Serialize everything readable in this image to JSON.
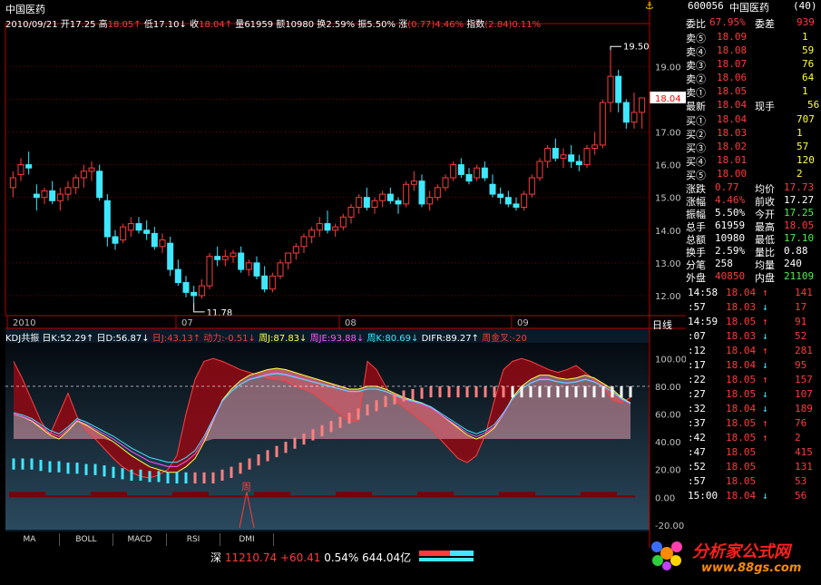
{
  "header": {
    "title": "中国医药",
    "date": "2010/09/21",
    "quote": [
      {
        "label": "开",
        "value": "17.25",
        "dir": "",
        "cls": "white"
      },
      {
        "label": "高",
        "value": "18.05",
        "dir": "↑",
        "cls": "red"
      },
      {
        "label": "低",
        "value": "17.10",
        "dir": "↓",
        "cls": "white"
      },
      {
        "label": "收",
        "value": "18.04",
        "dir": "↑",
        "cls": "red"
      },
      {
        "label": "量",
        "value": "61959",
        "dir": "",
        "cls": "white"
      },
      {
        "label": "额",
        "value": "10980",
        "dir": "",
        "cls": "white"
      },
      {
        "label": "换",
        "value": "2.59%",
        "dir": "",
        "cls": "white"
      },
      {
        "label": "振",
        "value": "5.50%",
        "dir": "",
        "cls": "white"
      },
      {
        "label": "涨",
        "value": "(0.77)4.46%",
        "dir": "",
        "cls": "red"
      },
      {
        "label": "指数",
        "value": "(2.84)0.11%",
        "dir": "",
        "cls": "red"
      }
    ]
  },
  "chart_data": [
    {
      "type": "candlestick",
      "title": "",
      "y_ticks": [
        "19.00",
        "18.00",
        "17.00",
        "16.00",
        "15.00",
        "14.00",
        "13.00",
        "12.00"
      ],
      "ylim": [
        11.5,
        20.2
      ],
      "x_ticks": [
        "2010",
        "07",
        "08",
        "09"
      ],
      "current_price": "18.04",
      "high_marker": "19.50",
      "low_marker": "11.78",
      "candles": [
        [
          15.3,
          15.8,
          15.0,
          15.6
        ],
        [
          15.7,
          16.2,
          15.5,
          16.0
        ],
        [
          16.0,
          16.4,
          15.7,
          15.9
        ],
        [
          15.1,
          15.4,
          14.6,
          15.0
        ],
        [
          15.0,
          15.3,
          14.8,
          15.2
        ],
        [
          15.2,
          15.5,
          14.8,
          14.9
        ],
        [
          14.9,
          15.3,
          14.6,
          15.1
        ],
        [
          15.1,
          15.5,
          14.9,
          15.3
        ],
        [
          15.3,
          15.7,
          15.1,
          15.6
        ],
        [
          15.6,
          16.0,
          15.3,
          15.8
        ],
        [
          15.8,
          16.1,
          15.5,
          15.9
        ],
        [
          15.8,
          16.0,
          14.9,
          15.0
        ],
        [
          14.9,
          15.1,
          13.5,
          13.8
        ],
        [
          13.8,
          14.0,
          13.4,
          13.6
        ],
        [
          13.7,
          14.2,
          13.6,
          14.1
        ],
        [
          14.0,
          14.4,
          13.8,
          14.2
        ],
        [
          14.2,
          14.4,
          13.9,
          14.0
        ],
        [
          14.0,
          14.3,
          13.7,
          13.9
        ],
        [
          13.9,
          14.1,
          13.4,
          13.5
        ],
        [
          13.5,
          13.9,
          13.3,
          13.7
        ],
        [
          13.6,
          13.8,
          12.6,
          12.8
        ],
        [
          12.8,
          13.1,
          12.3,
          12.4
        ],
        [
          12.4,
          12.6,
          11.95,
          12.1
        ],
        [
          12.1,
          12.3,
          11.78,
          12.0
        ],
        [
          12.0,
          12.5,
          11.9,
          12.3
        ],
        [
          12.3,
          13.3,
          12.2,
          13.2
        ],
        [
          13.2,
          13.5,
          12.9,
          13.1
        ],
        [
          13.1,
          13.4,
          12.9,
          13.2
        ],
        [
          13.2,
          13.4,
          13.0,
          13.3
        ],
        [
          13.3,
          13.5,
          12.7,
          12.8
        ],
        [
          12.8,
          13.1,
          12.6,
          13.0
        ],
        [
          13.0,
          13.2,
          12.5,
          12.6
        ],
        [
          12.6,
          12.9,
          12.1,
          12.2
        ],
        [
          12.2,
          12.7,
          12.1,
          12.6
        ],
        [
          12.6,
          13.1,
          12.5,
          13.0
        ],
        [
          13.0,
          13.3,
          12.8,
          13.3
        ],
        [
          13.3,
          13.6,
          13.1,
          13.5
        ],
        [
          13.5,
          13.9,
          13.3,
          13.8
        ],
        [
          13.8,
          14.1,
          13.6,
          14.0
        ],
        [
          14.0,
          14.4,
          13.8,
          14.2
        ],
        [
          14.2,
          14.6,
          13.9,
          14.0
        ],
        [
          14.0,
          14.2,
          13.8,
          14.1
        ],
        [
          14.1,
          14.5,
          14.0,
          14.4
        ],
        [
          14.4,
          14.8,
          14.2,
          14.7
        ],
        [
          14.7,
          15.1,
          14.5,
          15.0
        ],
        [
          15.0,
          15.3,
          14.6,
          14.7
        ],
        [
          14.7,
          15.0,
          14.5,
          14.9
        ],
        [
          14.9,
          15.2,
          14.7,
          15.1
        ],
        [
          15.1,
          15.3,
          14.8,
          14.9
        ],
        [
          14.9,
          15.0,
          14.5,
          14.8
        ],
        [
          14.8,
          15.5,
          14.7,
          15.4
        ],
        [
          15.4,
          15.8,
          15.2,
          15.5
        ],
        [
          15.5,
          15.7,
          14.7,
          14.8
        ],
        [
          14.8,
          15.2,
          14.6,
          15.0
        ],
        [
          15.0,
          15.4,
          14.9,
          15.3
        ],
        [
          15.3,
          15.7,
          15.2,
          15.6
        ],
        [
          15.6,
          16.1,
          15.5,
          16.0
        ],
        [
          16.0,
          16.2,
          15.6,
          15.7
        ],
        [
          15.7,
          15.9,
          15.4,
          15.5
        ],
        [
          15.6,
          16.0,
          15.5,
          15.9
        ],
        [
          15.9,
          16.1,
          15.5,
          15.6
        ],
        [
          15.4,
          15.7,
          15.0,
          15.1
        ],
        [
          15.1,
          15.3,
          14.8,
          15.0
        ],
        [
          15.0,
          15.2,
          14.7,
          14.8
        ],
        [
          14.8,
          15.0,
          14.6,
          14.7
        ],
        [
          14.7,
          15.2,
          14.6,
          15.1
        ],
        [
          15.1,
          15.7,
          15.0,
          15.6
        ],
        [
          15.6,
          16.2,
          15.5,
          16.1
        ],
        [
          16.1,
          16.6,
          15.9,
          16.5
        ],
        [
          16.5,
          16.8,
          16.1,
          16.2
        ],
        [
          16.2,
          16.5,
          15.9,
          16.3
        ],
        [
          16.3,
          16.6,
          15.9,
          16.1
        ],
        [
          16.1,
          16.3,
          15.8,
          16.0
        ],
        [
          16.0,
          16.6,
          15.9,
          16.5
        ],
        [
          16.5,
          17.0,
          16.3,
          16.6
        ],
        [
          16.6,
          18.0,
          16.5,
          17.9
        ],
        [
          17.9,
          19.5,
          17.6,
          18.7
        ],
        [
          18.7,
          18.9,
          17.6,
          17.9
        ],
        [
          17.9,
          18.0,
          17.1,
          17.3
        ],
        [
          17.3,
          18.2,
          17.1,
          17.6
        ],
        [
          17.6,
          18.05,
          17.1,
          18.04
        ]
      ]
    },
    {
      "type": "indicator",
      "title": "KDJ共振",
      "legend": [
        {
          "text": "KDJ共振 日K:52.29↑",
          "cls": "white"
        },
        {
          "text": "日D:56.87↓",
          "cls": "white"
        },
        {
          "text": "日J:43.13↑",
          "cls": "red"
        },
        {
          "text": "动力:-0.51↓",
          "cls": "red"
        },
        {
          "text": "周J:87.83↓",
          "cls": "yellow"
        },
        {
          "text": "周JE:93.88↓",
          "cls": "mag"
        },
        {
          "text": "周K:80.69↓",
          "cls": "cyan"
        },
        {
          "text": "DIFR:89.27↑",
          "cls": "white"
        },
        {
          "text": "周金叉:-20",
          "cls": "red"
        }
      ],
      "y_ticks": [
        "100.00",
        "80.00",
        "60.00",
        "40.00",
        "20.00",
        "0.00",
        "-20.00"
      ],
      "ylim": [
        -22,
        110
      ],
      "j_band": [
        98,
        85,
        70,
        55,
        45,
        60,
        75,
        58,
        48,
        42,
        35,
        28,
        22,
        18,
        15,
        14,
        16,
        20,
        30,
        60,
        85,
        98,
        100,
        98,
        95,
        92,
        90,
        88,
        86,
        85,
        84,
        80,
        78,
        75,
        70,
        65,
        60,
        55,
        55,
        98,
        92,
        80,
        70,
        65,
        60,
        55,
        50,
        42,
        35,
        28,
        25,
        30,
        45,
        70,
        92,
        98,
        100,
        98,
        95,
        92,
        90,
        92,
        95,
        90,
        85,
        80,
        70,
        68,
        72
      ],
      "k_band": [
        60,
        58,
        55,
        50,
        45,
        42,
        48,
        55,
        52,
        48,
        44,
        40,
        35,
        30,
        26,
        22,
        20,
        18,
        18,
        22,
        28,
        40,
        55,
        70,
        78,
        84,
        88,
        90,
        92,
        93,
        92,
        90,
        88,
        86,
        84,
        82,
        80,
        78,
        78,
        80,
        80,
        78,
        75,
        72,
        70,
        68,
        65,
        60,
        55,
        50,
        45,
        42,
        45,
        50,
        60,
        72,
        80,
        85,
        88,
        88,
        86,
        85,
        86,
        88,
        86,
        82,
        78,
        72,
        68
      ],
      "weekly_bars": [
        28,
        28,
        28,
        27,
        26,
        26,
        25,
        25,
        24,
        24,
        23,
        22,
        21,
        20,
        20,
        19,
        19,
        18,
        18,
        18,
        18,
        18,
        18,
        20,
        22,
        25,
        28,
        31,
        34,
        37,
        40,
        43,
        46,
        49,
        52,
        55,
        58,
        61,
        64,
        67,
        70,
        73,
        75,
        77,
        78,
        79,
        80,
        80,
        80,
        80,
        80,
        80,
        80,
        80,
        80,
        80,
        80,
        80,
        80,
        80,
        80,
        80,
        80,
        80,
        80,
        80,
        80,
        80,
        80
      ],
      "cross_marker": "周"
    }
  ],
  "period_label": "日线",
  "tabs": [
    "MA",
    "BOLL",
    "MACD",
    "RSI",
    "DMI"
  ],
  "status": {
    "market": "深",
    "index": "11210.74",
    "change": "+60.41",
    "pct": "0.54%",
    "amount": "644.04亿"
  },
  "side": {
    "code": "600056",
    "name": "中国医药",
    "count": "(40)",
    "weibi": {
      "l1": "委比",
      "v1": "67.95%",
      "l2": "委差",
      "v2": "939"
    },
    "sells": [
      {
        "label": "卖⑤",
        "price": "18.09",
        "vol": "1"
      },
      {
        "label": "卖④",
        "price": "18.08",
        "vol": "59"
      },
      {
        "label": "卖③",
        "price": "18.07",
        "vol": "76"
      },
      {
        "label": "卖②",
        "price": "18.06",
        "vol": "64"
      },
      {
        "label": "卖①",
        "price": "18.05",
        "vol": "1"
      }
    ],
    "last": {
      "l1": "最新",
      "v1": "18.04",
      "l2": "现手",
      "v2": "56"
    },
    "buys": [
      {
        "label": "买①",
        "price": "18.04",
        "vol": "707"
      },
      {
        "label": "买②",
        "price": "18.03",
        "vol": "1"
      },
      {
        "label": "买③",
        "price": "18.02",
        "vol": "57"
      },
      {
        "label": "买④",
        "price": "18.01",
        "vol": "120"
      },
      {
        "label": "买⑤",
        "price": "18.00",
        "vol": "2"
      }
    ],
    "stats": [
      {
        "l1": "涨跌",
        "v1": "0.77",
        "c1": "red",
        "l2": "均价",
        "v2": "17.73",
        "c2": "red"
      },
      {
        "l1": "涨幅",
        "v1": "4.46%",
        "c1": "red",
        "l2": "前收",
        "v2": "17.27",
        "c2": "white"
      },
      {
        "l1": "振幅",
        "v1": "5.50%",
        "c1": "white",
        "l2": "今开",
        "v2": "17.25",
        "c2": "green"
      },
      {
        "l1": "总手",
        "v1": "61959",
        "c1": "white",
        "l2": "最高",
        "v2": "18.05",
        "c2": "red"
      },
      {
        "l1": "总额",
        "v1": "10980",
        "c1": "white",
        "l2": "最低",
        "v2": "17.10",
        "c2": "green"
      },
      {
        "l1": "换手",
        "v1": "2.59%",
        "c1": "white",
        "l2": "量比",
        "v2": "0.88",
        "c2": "white"
      },
      {
        "l1": "分笔",
        "v1": "258",
        "c1": "white",
        "l2": "均量",
        "v2": "240",
        "c2": "white"
      }
    ],
    "outer": {
      "l1": "外盘",
      "v1": "40850",
      "l2": "内盘",
      "v2": "21109"
    },
    "ticks": [
      {
        "t": "14:58",
        "p": "18.04",
        "a": "↑",
        "v": "141",
        "pc": "red",
        "ac": "red"
      },
      {
        "t": ":57",
        "p": "18.03",
        "a": "↓",
        "v": "17",
        "pc": "red",
        "ac": "cyan"
      },
      {
        "t": "14:59",
        "p": "18.05",
        "a": "↑",
        "v": "91",
        "pc": "red",
        "ac": "red"
      },
      {
        "t": ":07",
        "p": "18.03",
        "a": "↓",
        "v": "52",
        "pc": "red",
        "ac": "cyan"
      },
      {
        "t": ":12",
        "p": "18.04",
        "a": "↑",
        "v": "281",
        "pc": "red",
        "ac": "red"
      },
      {
        "t": ":17",
        "p": "18.04",
        "a": "↓",
        "v": "95",
        "pc": "red",
        "ac": "cyan"
      },
      {
        "t": ":22",
        "p": "18.05",
        "a": "↑",
        "v": "157",
        "pc": "red",
        "ac": "red"
      },
      {
        "t": ":27",
        "p": "18.05",
        "a": "↓",
        "v": "107",
        "pc": "red",
        "ac": "cyan"
      },
      {
        "t": ":32",
        "p": "18.04",
        "a": "↓",
        "v": "189",
        "pc": "red",
        "ac": "cyan"
      },
      {
        "t": ":37",
        "p": "18.05",
        "a": "↑",
        "v": "76",
        "pc": "red",
        "ac": "red"
      },
      {
        "t": ":42",
        "p": "18.05",
        "a": "↑",
        "v": "2",
        "pc": "red",
        "ac": "red"
      },
      {
        "t": ":47",
        "p": "18.05",
        "a": "",
        "v": "415",
        "pc": "red",
        "ac": "red"
      },
      {
        "t": ":52",
        "p": "18.05",
        "a": "",
        "v": "131",
        "pc": "red",
        "ac": "red"
      },
      {
        "t": ":57",
        "p": "18.05",
        "a": "",
        "v": "53",
        "pc": "red",
        "ac": "red"
      },
      {
        "t": "15:00",
        "p": "18.04",
        "a": "↓",
        "v": "56",
        "pc": "red",
        "ac": "cyan"
      }
    ]
  },
  "logo": {
    "text": "分析家公式网",
    "url": "www.88gs.com"
  },
  "colors": {
    "up": "#ff3b3b",
    "down": "#3fe8ff",
    "grid": "#8b0000",
    "frame": "#b30000"
  }
}
